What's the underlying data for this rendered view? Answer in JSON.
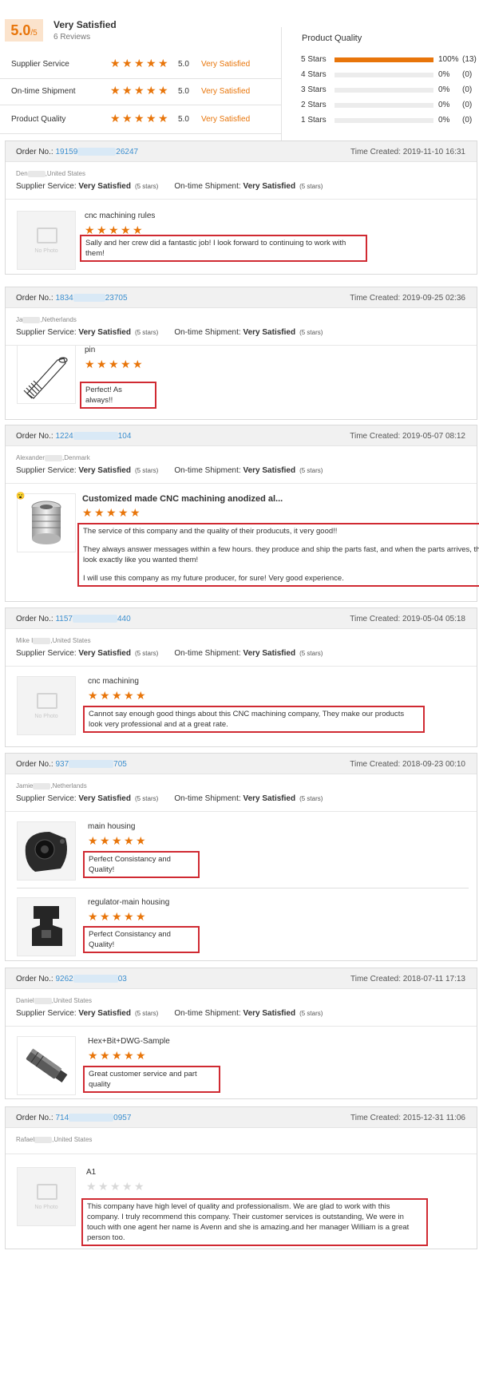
{
  "summary": {
    "score": "5.0",
    "score_suffix": "/5",
    "overall_label": "Very Satisfied",
    "reviews_count": "6 Reviews",
    "dimensions": [
      {
        "label": "Supplier Service",
        "value": "5.0",
        "text": "Very Satisfied",
        "stars": 5
      },
      {
        "label": "On-time Shipment",
        "value": "5.0",
        "text": "Very Satisfied",
        "stars": 5
      },
      {
        "label": "Product Quality",
        "value": "5.0",
        "text": "Very Satisfied",
        "stars": 5
      }
    ],
    "product_quality_title": "Product Quality",
    "distribution": [
      {
        "label": "5 Stars",
        "fraction": 1.0,
        "pct": "100%",
        "count": "(13)"
      },
      {
        "label": "4 Stars",
        "fraction": 0,
        "pct": "0%",
        "count": "(0)"
      },
      {
        "label": "3 Stars",
        "fraction": 0,
        "pct": "0%",
        "count": "(0)"
      },
      {
        "label": "2 Stars",
        "fraction": 0,
        "pct": "0%",
        "count": "(0)"
      },
      {
        "label": "1 Stars",
        "fraction": 0,
        "pct": "0%",
        "count": "(0)"
      }
    ]
  },
  "labels": {
    "order_no": "Order No.:",
    "time_created": "Time Created:",
    "supplier_service": "Supplier Service:",
    "ontime_shipment": "On-time Shipment:",
    "very_satisfied": "Very Satisfied",
    "five_stars": "(5 stars)",
    "no_photo": "No Photo"
  },
  "colors": {
    "accent": "#e8750a",
    "link": "#3b8fd0",
    "highlight_border": "#d02a32",
    "header_bg": "#f1f1f1"
  },
  "reviews": [
    {
      "order_prefix": "19159",
      "order_suffix": "26247",
      "time": "2019-11-10 16:31",
      "buyer_prefix": "Den",
      "buyer_location": "United States",
      "items": [
        {
          "name": "cnc machining rules",
          "stars": 5,
          "image": "no-photo",
          "text": [
            "Sally and her crew did a fantastic job! I look forward to continuing to work with them!"
          ]
        }
      ]
    },
    {
      "order_prefix": "1834",
      "order_suffix": "23705",
      "time": "2019-09-25 02:36",
      "buyer_prefix": "Ja",
      "buyer_location": "Netherlands",
      "items": [
        {
          "name": "pin",
          "stars": 5,
          "image": "pin-drawing",
          "text": [
            "Perfect! As always!!"
          ]
        }
      ]
    },
    {
      "order_prefix": "1224",
      "order_suffix": "104",
      "time": "2019-05-07 08:12",
      "buyer_prefix": "Alexander",
      "buyer_location": "Denmark",
      "items": [
        {
          "name": "Customized made CNC machining anodized al...",
          "stars": 5,
          "image": "anodized-part",
          "text": [
            "The service of this company and the quality of their producuts, it very good!!",
            "They always answer messages within a few hours. they produce and ship the parts fast, and when the parts arrives, they look exactly like you wanted them!",
            "I will use this company as my future producer, for sure! Very good experience."
          ]
        }
      ]
    },
    {
      "order_prefix": "1157",
      "order_suffix": "440",
      "time": "2019-05-04 05:18",
      "buyer_prefix": "Mike I",
      "buyer_location": "United States",
      "items": [
        {
          "name": "cnc machining",
          "stars": 5,
          "image": "no-photo",
          "text": [
            "Cannot say enough good things about this CNC machining company, They make our products look very professional and at a great rate."
          ]
        }
      ]
    },
    {
      "order_prefix": "937",
      "order_suffix": "705",
      "time": "2018-09-23 00:10",
      "buyer_prefix": "Jamie",
      "buyer_location": "Netherlands",
      "items": [
        {
          "name": "main housing",
          "stars": 5,
          "image": "black-housing",
          "text": [
            "Perfect Consistancy and Quality!"
          ]
        },
        {
          "name": "regulator-main housing",
          "stars": 5,
          "image": "black-regulator",
          "text": [
            "Perfect Consistancy and Quality!"
          ]
        }
      ]
    },
    {
      "order_prefix": "9262",
      "order_suffix": "03",
      "time": "2018-07-11 17:13",
      "buyer_prefix": "Daniel",
      "buyer_location": "United States",
      "items": [
        {
          "name": "Hex+Bit+DWG-Sample",
          "stars": 5,
          "image": "hex-bit",
          "text": [
            "Great customer service and part quality"
          ]
        }
      ]
    },
    {
      "order_prefix": "714",
      "order_suffix": "0957",
      "time": "2015-12-31 11:06",
      "buyer_prefix": "Rafael",
      "buyer_location": "United States",
      "items": [
        {
          "name": "A1",
          "stars": 0,
          "image": "no-photo",
          "text": [
            "This company have high level of quality and professionalism. We are glad to work with this company. I truly recommend this company.  Their customer services is outstanding,  We were in touch with one agent her name is Avenn and she is amazing.and her manager William is a great person too."
          ]
        }
      ]
    }
  ]
}
